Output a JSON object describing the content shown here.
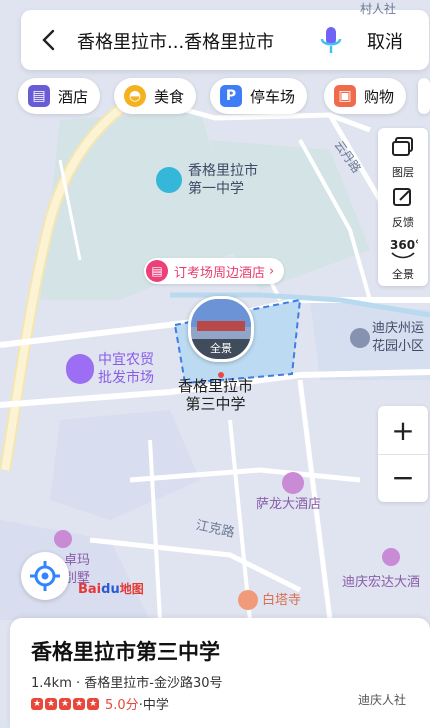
{
  "search": {
    "query": "香格里拉市...香格里拉市",
    "cancel_label": "取消"
  },
  "chips": [
    {
      "label": "酒店",
      "icon": "hotel-icon",
      "color": "#6a5bd6"
    },
    {
      "label": "美食",
      "icon": "food-icon",
      "color": "#f5b21f"
    },
    {
      "label": "停车场",
      "icon": "parking-icon",
      "color": "#3f7df6"
    },
    {
      "label": "购物",
      "icon": "shopping-icon",
      "color": "#f06a4c"
    }
  ],
  "tools": {
    "layers": "图层",
    "feedback": "反馈",
    "panorama": "全景"
  },
  "map_labels": {
    "school1_line1": "香格里拉市",
    "school1_line2": "第一中学",
    "road_yundan": "云丹路",
    "hotel_promo": "订考场周边酒店",
    "panorama_badge": "全景",
    "market_line1": "中宜农贸",
    "market_line2": "批发市场",
    "school3_line1": "香格里拉市",
    "school3_line2": "第三中学",
    "diqing_line1": "迪庆州运",
    "diqing_line2": "花园小区",
    "salong": "萨龙大酒店",
    "jiangke": "江克路",
    "zhuoma_line1": "卓玛",
    "zhuoma_line2": "别墅",
    "baitasi": "白塔寺",
    "hongda": "迪庆宏达大酒",
    "top_fragment": "村人社"
  },
  "logo": {
    "bai": "Bai",
    "du": "du",
    "map": "地图"
  },
  "place": {
    "name": "香格里拉市第三中学",
    "info": "1.4km · 香格里拉市-金沙路30号",
    "rating": "5.0分",
    "category": "·中学",
    "watermark": "迪庆人社"
  },
  "colors": {
    "accent": "#3385ff",
    "star": "#e8473b",
    "promo": "#ec407a"
  }
}
